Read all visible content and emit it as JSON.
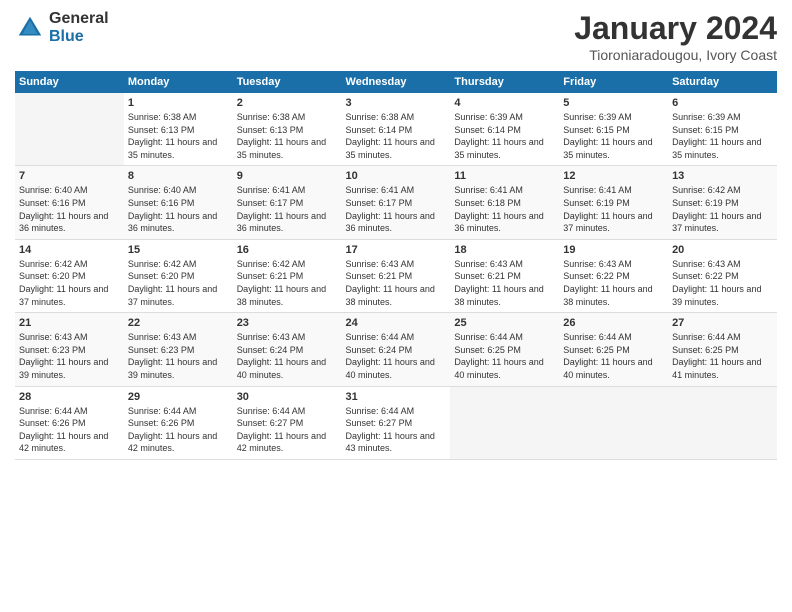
{
  "logo": {
    "general": "General",
    "blue": "Blue"
  },
  "title": "January 2024",
  "subtitle": "Tioroniaradougou, Ivory Coast",
  "days_header": [
    "Sunday",
    "Monday",
    "Tuesday",
    "Wednesday",
    "Thursday",
    "Friday",
    "Saturday"
  ],
  "weeks": [
    [
      {
        "day": "",
        "empty": true
      },
      {
        "day": "1",
        "sunrise": "Sunrise: 6:38 AM",
        "sunset": "Sunset: 6:13 PM",
        "daylight": "Daylight: 11 hours and 35 minutes."
      },
      {
        "day": "2",
        "sunrise": "Sunrise: 6:38 AM",
        "sunset": "Sunset: 6:13 PM",
        "daylight": "Daylight: 11 hours and 35 minutes."
      },
      {
        "day": "3",
        "sunrise": "Sunrise: 6:38 AM",
        "sunset": "Sunset: 6:14 PM",
        "daylight": "Daylight: 11 hours and 35 minutes."
      },
      {
        "day": "4",
        "sunrise": "Sunrise: 6:39 AM",
        "sunset": "Sunset: 6:14 PM",
        "daylight": "Daylight: 11 hours and 35 minutes."
      },
      {
        "day": "5",
        "sunrise": "Sunrise: 6:39 AM",
        "sunset": "Sunset: 6:15 PM",
        "daylight": "Daylight: 11 hours and 35 minutes."
      },
      {
        "day": "6",
        "sunrise": "Sunrise: 6:39 AM",
        "sunset": "Sunset: 6:15 PM",
        "daylight": "Daylight: 11 hours and 35 minutes."
      }
    ],
    [
      {
        "day": "7",
        "sunrise": "Sunrise: 6:40 AM",
        "sunset": "Sunset: 6:16 PM",
        "daylight": "Daylight: 11 hours and 36 minutes."
      },
      {
        "day": "8",
        "sunrise": "Sunrise: 6:40 AM",
        "sunset": "Sunset: 6:16 PM",
        "daylight": "Daylight: 11 hours and 36 minutes."
      },
      {
        "day": "9",
        "sunrise": "Sunrise: 6:41 AM",
        "sunset": "Sunset: 6:17 PM",
        "daylight": "Daylight: 11 hours and 36 minutes."
      },
      {
        "day": "10",
        "sunrise": "Sunrise: 6:41 AM",
        "sunset": "Sunset: 6:17 PM",
        "daylight": "Daylight: 11 hours and 36 minutes."
      },
      {
        "day": "11",
        "sunrise": "Sunrise: 6:41 AM",
        "sunset": "Sunset: 6:18 PM",
        "daylight": "Daylight: 11 hours and 36 minutes."
      },
      {
        "day": "12",
        "sunrise": "Sunrise: 6:41 AM",
        "sunset": "Sunset: 6:19 PM",
        "daylight": "Daylight: 11 hours and 37 minutes."
      },
      {
        "day": "13",
        "sunrise": "Sunrise: 6:42 AM",
        "sunset": "Sunset: 6:19 PM",
        "daylight": "Daylight: 11 hours and 37 minutes."
      }
    ],
    [
      {
        "day": "14",
        "sunrise": "Sunrise: 6:42 AM",
        "sunset": "Sunset: 6:20 PM",
        "daylight": "Daylight: 11 hours and 37 minutes."
      },
      {
        "day": "15",
        "sunrise": "Sunrise: 6:42 AM",
        "sunset": "Sunset: 6:20 PM",
        "daylight": "Daylight: 11 hours and 37 minutes."
      },
      {
        "day": "16",
        "sunrise": "Sunrise: 6:42 AM",
        "sunset": "Sunset: 6:21 PM",
        "daylight": "Daylight: 11 hours and 38 minutes."
      },
      {
        "day": "17",
        "sunrise": "Sunrise: 6:43 AM",
        "sunset": "Sunset: 6:21 PM",
        "daylight": "Daylight: 11 hours and 38 minutes."
      },
      {
        "day": "18",
        "sunrise": "Sunrise: 6:43 AM",
        "sunset": "Sunset: 6:21 PM",
        "daylight": "Daylight: 11 hours and 38 minutes."
      },
      {
        "day": "19",
        "sunrise": "Sunrise: 6:43 AM",
        "sunset": "Sunset: 6:22 PM",
        "daylight": "Daylight: 11 hours and 38 minutes."
      },
      {
        "day": "20",
        "sunrise": "Sunrise: 6:43 AM",
        "sunset": "Sunset: 6:22 PM",
        "daylight": "Daylight: 11 hours and 39 minutes."
      }
    ],
    [
      {
        "day": "21",
        "sunrise": "Sunrise: 6:43 AM",
        "sunset": "Sunset: 6:23 PM",
        "daylight": "Daylight: 11 hours and 39 minutes."
      },
      {
        "day": "22",
        "sunrise": "Sunrise: 6:43 AM",
        "sunset": "Sunset: 6:23 PM",
        "daylight": "Daylight: 11 hours and 39 minutes."
      },
      {
        "day": "23",
        "sunrise": "Sunrise: 6:43 AM",
        "sunset": "Sunset: 6:24 PM",
        "daylight": "Daylight: 11 hours and 40 minutes."
      },
      {
        "day": "24",
        "sunrise": "Sunrise: 6:44 AM",
        "sunset": "Sunset: 6:24 PM",
        "daylight": "Daylight: 11 hours and 40 minutes."
      },
      {
        "day": "25",
        "sunrise": "Sunrise: 6:44 AM",
        "sunset": "Sunset: 6:25 PM",
        "daylight": "Daylight: 11 hours and 40 minutes."
      },
      {
        "day": "26",
        "sunrise": "Sunrise: 6:44 AM",
        "sunset": "Sunset: 6:25 PM",
        "daylight": "Daylight: 11 hours and 40 minutes."
      },
      {
        "day": "27",
        "sunrise": "Sunrise: 6:44 AM",
        "sunset": "Sunset: 6:25 PM",
        "daylight": "Daylight: 11 hours and 41 minutes."
      }
    ],
    [
      {
        "day": "28",
        "sunrise": "Sunrise: 6:44 AM",
        "sunset": "Sunset: 6:26 PM",
        "daylight": "Daylight: 11 hours and 42 minutes."
      },
      {
        "day": "29",
        "sunrise": "Sunrise: 6:44 AM",
        "sunset": "Sunset: 6:26 PM",
        "daylight": "Daylight: 11 hours and 42 minutes."
      },
      {
        "day": "30",
        "sunrise": "Sunrise: 6:44 AM",
        "sunset": "Sunset: 6:27 PM",
        "daylight": "Daylight: 11 hours and 42 minutes."
      },
      {
        "day": "31",
        "sunrise": "Sunrise: 6:44 AM",
        "sunset": "Sunset: 6:27 PM",
        "daylight": "Daylight: 11 hours and 43 minutes."
      },
      {
        "day": "",
        "empty": true
      },
      {
        "day": "",
        "empty": true
      },
      {
        "day": "",
        "empty": true
      }
    ]
  ]
}
